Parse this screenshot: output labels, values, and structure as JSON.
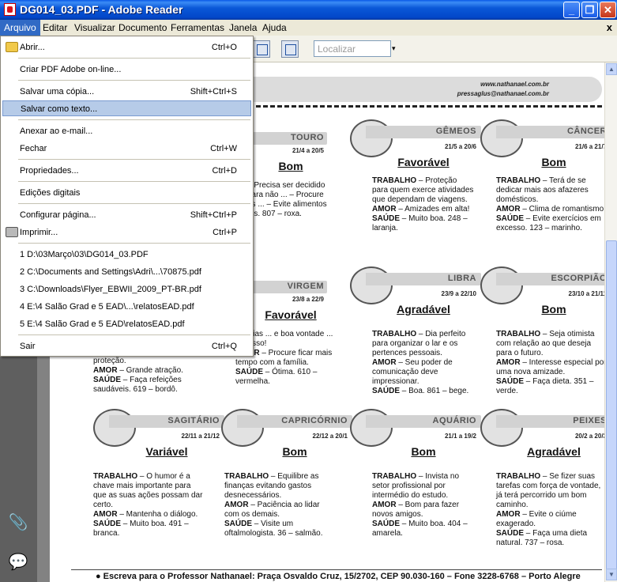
{
  "window": {
    "title": "DG014_03.PDF - Adobe Reader",
    "controls": {
      "minimize": "_",
      "restore": "❐",
      "close": "✕"
    }
  },
  "menubar": {
    "items": [
      "Arquivo",
      "Editar",
      "Visualizar",
      "Documento",
      "Ferramentas",
      "Janela",
      "Ajuda"
    ],
    "doc_close": "x"
  },
  "toolbar": {
    "search_placeholder": "Localizar",
    "dropdown_arrow": "▾"
  },
  "file_menu": {
    "open": {
      "label": "Abrir...",
      "shortcut": "Ctrl+O"
    },
    "create_pdf": {
      "label": "Criar PDF Adobe on-line..."
    },
    "save_copy": {
      "label": "Salvar uma cópia...",
      "shortcut": "Shift+Ctrl+S"
    },
    "save_text": {
      "label": "Salvar como texto..."
    },
    "attach_email": {
      "label": "Anexar ao e-mail..."
    },
    "close": {
      "label": "Fechar",
      "shortcut": "Ctrl+W"
    },
    "properties": {
      "label": "Propriedades...",
      "shortcut": "Ctrl+D"
    },
    "digital_editions": {
      "label": "Edições digitais"
    },
    "page_setup": {
      "label": "Configurar página...",
      "shortcut": "Shift+Ctrl+P"
    },
    "print": {
      "label": "Imprimir...",
      "shortcut": "Ctrl+P"
    },
    "recent": [
      "1 D:\\03Março\\03\\DG014_03.PDF",
      "2 C:\\Documents and Settings\\Adri\\...\\70875.pdf",
      "3 C:\\Downloads\\Flyer_EBWII_2009_PT-BR.pdf",
      "4 E:\\4 Salão Grad e 5 EAD\\...\\relatosEAD.pdf",
      "5 E:\\4 Salão Grad e 5 EAD\\relatosEAD.pdf"
    ],
    "exit": {
      "label": "Sair",
      "shortcut": "Ctrl+Q"
    }
  },
  "page": {
    "site": "www.nathanael.com.br",
    "email": "pressaglus@nathanael.com.br",
    "signs": [
      {
        "name": "TOURO",
        "dates": "21/4 a 20/5",
        "forecast": "Bom",
        "text": "– Precisa ser decidido para não ... – Procure os ... – Evite alimentos ...s. 807 – roxa."
      },
      {
        "name": "GÊMEOS",
        "dates": "21/5 a 20/6",
        "forecast": "Favorável",
        "trabalho": "– Proteção para quem exerce atividades que dependam de viagens.",
        "amor": "– Amizades em alta!",
        "saude": "– Muito boa. 248 – laranja."
      },
      {
        "name": "CÂNCER",
        "dates": "21/6 a 21/7",
        "forecast": "Bom",
        "trabalho": "– Terá de se dedicar mais aos afazeres domésticos.",
        "amor": "– Clima de romantismo.",
        "saude": "– Evite exercícios em excesso. 123 – marinho."
      },
      {
        "name": "VIRGEM",
        "dates": "23/8 a 22/9",
        "forecast": "Favorável",
        "text": "– Idéias ... e boa vontade ... sucesso!",
        "amor": "– Procure ficar mais tempo com a família.",
        "saude": "– Ótima. 610 – vermelha."
      },
      {
        "name": "LIBRA",
        "dates": "23/9 a 22/10",
        "forecast": "Agradável",
        "trabalho": "– Dia perfeito para organizar o lar e os pertences pessoais.",
        "amor": "– Seu poder de comunicação deve impressionar.",
        "saude": "– Boa. 861 – bege."
      },
      {
        "name": "ESCORPIÃO",
        "dates": "23/10 a 21/11",
        "forecast": "Bom",
        "trabalho": "– Seja otimista com relação ao que deseja para o futuro.",
        "amor": "– Interesse especial por uma nova amizade.",
        "saude": "– Faça dieta. 351 – verde."
      },
      {
        "name": "SAGITÁRIO",
        "dates": "22/11 a 21/12",
        "forecast": "Variável",
        "trabalho": "– O humor é a chave mais importante para que as suas ações possam dar certo.",
        "amor": "– Mantenha o diálogo.",
        "saude": "– Muito boa. 491 – branca."
      },
      {
        "name": "CAPRICÓRNIO",
        "dates": "22/12 a 20/1",
        "forecast": "Bom",
        "trabalho": "– Equilibre as finanças evitando gastos desnecessários.",
        "amor": "– Paciência ao lidar com os demais.",
        "saude": "– Visite um oftalmologista. 36 – salmão."
      },
      {
        "name": "AQUÁRIO",
        "dates": "21/1 a 19/2",
        "forecast": "Bom",
        "trabalho": "– Invista no setor profissional por intermédio do estudo.",
        "amor": "– Bom para fazer novos amigos.",
        "saude": "– Muito boa. 404 – amarela."
      },
      {
        "name": "PEIXES",
        "dates": "20/2 a 20/3",
        "forecast": "Agradável",
        "trabalho": "– Se fizer suas tarefas com força de vontade, já terá percorrido um bom caminho.",
        "amor": "– Evite o ciúme exagerado.",
        "saude": "– Faça uma dieta natural. 737 – rosa."
      }
    ],
    "aries_tail": {
      "line1": "proteção.",
      "amor": "– Grande atração.",
      "saude": "– Faça refeições saudáveis. 619 – bordô."
    },
    "labels": {
      "trabalho": "TRABALHO",
      "amor": "AMOR",
      "saude": "SAÚDE"
    },
    "footer": "Escreva para o Professor Nathanael: Praça Osvaldo Cruz, 15/2702, CEP 90.030-160 – Fone 3228-6768 – Porto Alegre"
  },
  "panel": {
    "attach_icon": "📎",
    "comment_icon": "💬"
  },
  "scroll": {
    "up": "▲",
    "down": "▼"
  }
}
